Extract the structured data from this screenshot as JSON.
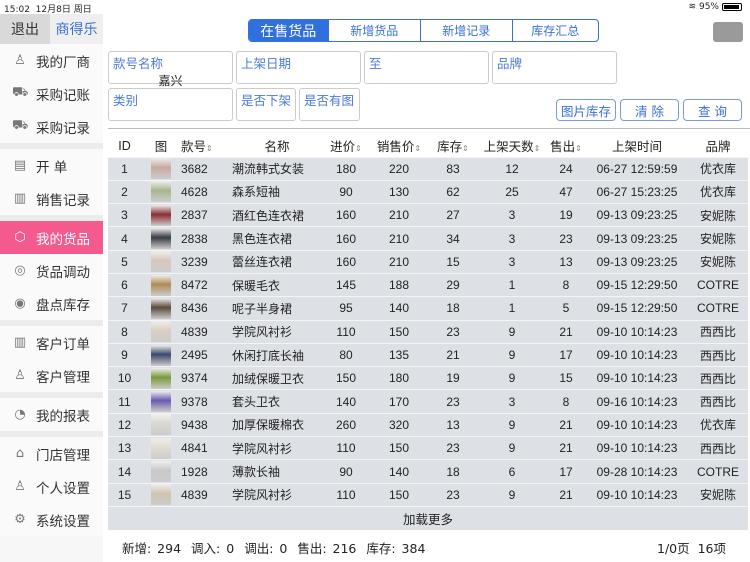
{
  "status": {
    "time": "15:02",
    "date": "12月8日 周日",
    "battery": "95%",
    "battery_level": 0.95
  },
  "sidebar": {
    "exit": "退出",
    "brand": "商得乐",
    "groups": [
      [
        {
          "label": "我的厂商",
          "icon": "user-icon"
        },
        {
          "label": "采购记账",
          "icon": "cart-icon"
        },
        {
          "label": "采购记录",
          "icon": "cart-icon"
        }
      ],
      [
        {
          "label": "开 单",
          "icon": "document-icon"
        },
        {
          "label": "销售记录",
          "icon": "receipt-icon"
        }
      ],
      [
        {
          "label": "我的货品",
          "icon": "box-icon",
          "active": true
        },
        {
          "label": "货品调动",
          "icon": "transfer-icon"
        },
        {
          "label": "盘点库存",
          "icon": "inventory-icon"
        }
      ],
      [
        {
          "label": "客户订单",
          "icon": "order-icon"
        },
        {
          "label": "客户管理",
          "icon": "customer-icon"
        }
      ],
      [
        {
          "label": "我的报表",
          "icon": "report-icon"
        }
      ],
      [
        {
          "label": "门店管理",
          "icon": "store-icon"
        },
        {
          "label": "个人设置",
          "icon": "person-icon"
        },
        {
          "label": "系统设置",
          "icon": "gear-icon"
        }
      ]
    ]
  },
  "tabs": [
    "在售货品",
    "新增货品",
    "新增记录",
    "库存汇总"
  ],
  "filters": {
    "code_name": {
      "label": "款号名称",
      "value": "嘉兴"
    },
    "date_from": "上架日期",
    "date_to": "至",
    "brand": "品牌",
    "category": "类别",
    "delisted": "是否下架",
    "has_image": "是否有图"
  },
  "buttons": {
    "image_stock": "图片库存",
    "clear": "清 除",
    "query": "查 询"
  },
  "table": {
    "headers": [
      "ID",
      "图",
      "款号",
      "名称",
      "进价",
      "销售价",
      "库存",
      "上架天数",
      "售出",
      "上架时间",
      "品牌"
    ],
    "rows": [
      [
        "1",
        "3682",
        "潮流韩式女装",
        "180",
        "220",
        "83",
        "12",
        "24",
        "06-27 12:59:59",
        "优衣库"
      ],
      [
        "2",
        "4628",
        "森系短袖",
        "90",
        "130",
        "62",
        "25",
        "47",
        "06-27 15:23:25",
        "优衣库"
      ],
      [
        "3",
        "2837",
        "酒红色连衣裙",
        "160",
        "210",
        "27",
        "3",
        "19",
        "09-13 09:23:25",
        "安妮陈"
      ],
      [
        "4",
        "2838",
        "黑色连衣裙",
        "160",
        "210",
        "34",
        "3",
        "23",
        "09-13 09:23:25",
        "安妮陈"
      ],
      [
        "5",
        "3239",
        "蕾丝连衣裙",
        "160",
        "210",
        "15",
        "3",
        "13",
        "09-13 09:23:25",
        "安妮陈"
      ],
      [
        "6",
        "8472",
        "保暖毛衣",
        "145",
        "188",
        "29",
        "1",
        "8",
        "09-15 12:29:50",
        "COTRE"
      ],
      [
        "7",
        "8436",
        "呢子半身裙",
        "95",
        "140",
        "18",
        "1",
        "5",
        "09-15 12:29:50",
        "COTRE"
      ],
      [
        "8",
        "4839",
        "学院风衬衫",
        "110",
        "150",
        "23",
        "9",
        "21",
        "09-10 10:14:23",
        "西西比"
      ],
      [
        "9",
        "2495",
        "休闲打底长袖",
        "80",
        "135",
        "21",
        "9",
        "17",
        "09-10 10:14:23",
        "西西比"
      ],
      [
        "10",
        "9374",
        "加绒保暖卫衣",
        "150",
        "180",
        "19",
        "9",
        "15",
        "09-10 10:14:23",
        "西西比"
      ],
      [
        "11",
        "9378",
        "套头卫衣",
        "140",
        "170",
        "23",
        "3",
        "8",
        "09-16 10:14:23",
        "西西比"
      ],
      [
        "12",
        "9438",
        "加厚保暖棉衣",
        "260",
        "320",
        "13",
        "9",
        "21",
        "09-10 10:14:23",
        "优衣库"
      ],
      [
        "13",
        "4841",
        "学院风衬衫",
        "110",
        "150",
        "23",
        "9",
        "21",
        "09-10 10:14:23",
        "西西比"
      ],
      [
        "14",
        "1928",
        "薄款长袖",
        "90",
        "140",
        "18",
        "6",
        "17",
        "09-28 10:14:23",
        "COTRE"
      ],
      [
        "15",
        "4839",
        "学院风衬衫",
        "110",
        "150",
        "23",
        "9",
        "21",
        "09-10 10:14:23",
        "安妮陈"
      ]
    ],
    "thumb_colors": [
      "#c9a9a0",
      "#a8b58f",
      "#8a2d35",
      "#3a3a45",
      "#d8c8bc",
      "#b08a55",
      "#5a4a3c",
      "#d9cfc0",
      "#3a4a6a",
      "#7a9a3a",
      "#6a5ab0",
      "#d8d8d0",
      "#e0dcd0",
      "#c8c8cc",
      "#d0c4b0"
    ],
    "load_more": "加载更多"
  },
  "footer": {
    "stats": [
      "新增: 294",
      "调入: 0",
      "调出: 0",
      "售出: 216",
      "库存: 384"
    ],
    "page": "1/0页",
    "count": "16项"
  },
  "colors": {
    "accent": "#2f6fde",
    "active": "#f45a8d"
  }
}
